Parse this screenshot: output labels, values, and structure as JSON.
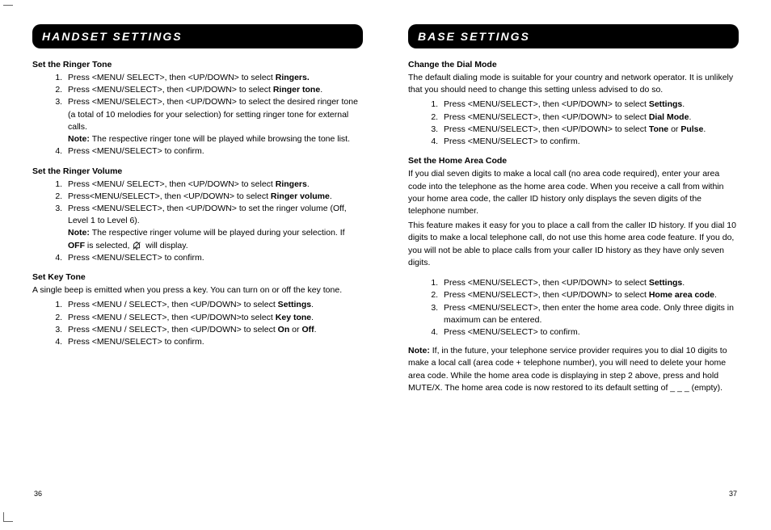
{
  "left": {
    "header": "HANDSET SETTINGS",
    "s1_title": "Set the Ringer Tone",
    "s1_li1a": "Press <MENU/ SELECT>, then <UP/DOWN> to select ",
    "s1_li1b": "Ringers.",
    "s1_li2a": "Press <MENU/SELECT>, then <UP/DOWN> to select ",
    "s1_li2b": "Ringer tone",
    "s1_li2c": ".",
    "s1_li3a": "Press <MENU/SELECT>, then <UP/DOWN> to select the desired ringer tone (a total of 10 melodies for your selection) for setting ringer tone for external calls.",
    "s1_li3_note_label": "Note: ",
    "s1_li3_note": "The respective ringer tone will be played while browsing the tone list.",
    "s1_li4": "Press <MENU/SELECT> to confirm.",
    "s2_title": "Set the Ringer Volume",
    "s2_li1a": "Press <MENU/ SELECT>, then <UP/DOWN> to select ",
    "s2_li1b": "Ringers",
    "s2_li1c": ".",
    "s2_li2a": "Press<MENU/SELECT>, then <UP/DOWN> to select ",
    "s2_li2b": "Ringer volume",
    "s2_li2c": ".",
    "s2_li3a": "Press <MENU/SELECT>, then <UP/DOWN> to set the ringer volume (Off, Level 1 to Level 6).",
    "s2_li3_note_label": "Note: ",
    "s2_li3_note_a": "The respective ringer volume will be played during your selection. If ",
    "s2_li3_note_b": "OFF",
    "s2_li3_note_c": " is selected, ",
    "s2_li3_note_d": " will display.",
    "s2_li4": "Press <MENU/SELECT> to confirm.",
    "s3_title": "Set Key Tone",
    "s3_intro": "A single beep is emitted when you press a key.  You can turn on or off the key tone.",
    "s3_li1a": "Press <MENU / SELECT>, then <UP/DOWN> to select ",
    "s3_li1b": "Settings",
    "s3_li1c": ".",
    "s3_li2a": "Press <MENU / SELECT>, then <UP/DOWN>to select ",
    "s3_li2b": "Key tone",
    "s3_li2c": ".",
    "s3_li3a": "Press <MENU / SELECT>, then <UP/DOWN> to select ",
    "s3_li3b": "On",
    "s3_li3c": " or ",
    "s3_li3d": "Off",
    "s3_li3e": ".",
    "s3_li4": "Press <MENU/SELECT> to confirm.",
    "pagenum": "36"
  },
  "right": {
    "header": "BASE SETTINGS",
    "s1_title": "Change the Dial Mode",
    "s1_intro": "The default dialing mode is suitable for your country and network operator. It is unlikely that you should need to change this setting unless advised to do so.",
    "s1_li1a": "Press <MENU/SELECT>, then <UP/DOWN> to select ",
    "s1_li1b": "Settings",
    "s1_li1c": ".",
    "s1_li2a": "Press <MENU/SELECT>, then <UP/DOWN> to select ",
    "s1_li2b": "Dial Mode",
    "s1_li2c": ".",
    "s1_li3a": "Press <MENU/SELECT>, then <UP/DOWN> to select ",
    "s1_li3b": "Tone",
    "s1_li3c": " or ",
    "s1_li3d": "Pulse",
    "s1_li3e": ".",
    "s1_li4": "Press <MENU/SELECT> to confirm.",
    "s2_title": "Set the Home Area Code",
    "s2_p1": "If you dial seven digits to make a local call (no area code required), enter your area code into the telephone as the home area code. When you receive a call from within your home area code, the caller ID history only displays the seven digits of the telephone number.",
    "s2_p2": "This feature makes it easy for you to place a call from the caller ID history. If you dial 10 digits to make a local telephone call, do not use this home area code feature. If you do, you will not be able to place calls from your caller ID history as they have only seven digits.",
    "s2_li1a": "Press <MENU/SELECT>, then <UP/DOWN> to select ",
    "s2_li1b": "Settings",
    "s2_li1c": ".",
    "s2_li2a": "Press <MENU/SELECT>, then <UP/DOWN> to select ",
    "s2_li2b": "Home area code",
    "s2_li2c": ".",
    "s2_li3": "Press <MENU/SELECT>, then enter the home area code. Only three digits in maximum can be entered.",
    "s2_li4": "Press <MENU/SELECT> to confirm.",
    "s2_note_label": "Note: ",
    "s2_note_body": "If, in the future, your telephone service provider requires you to dial 10 digits to make a local call (area code + telephone number), you will need to delete your home area code. While the home area code is displaying in step 2 above, press and hold MUTE/X. The home area code is now restored to its default setting of _ _ _ (empty).",
    "pagenum": "37"
  }
}
